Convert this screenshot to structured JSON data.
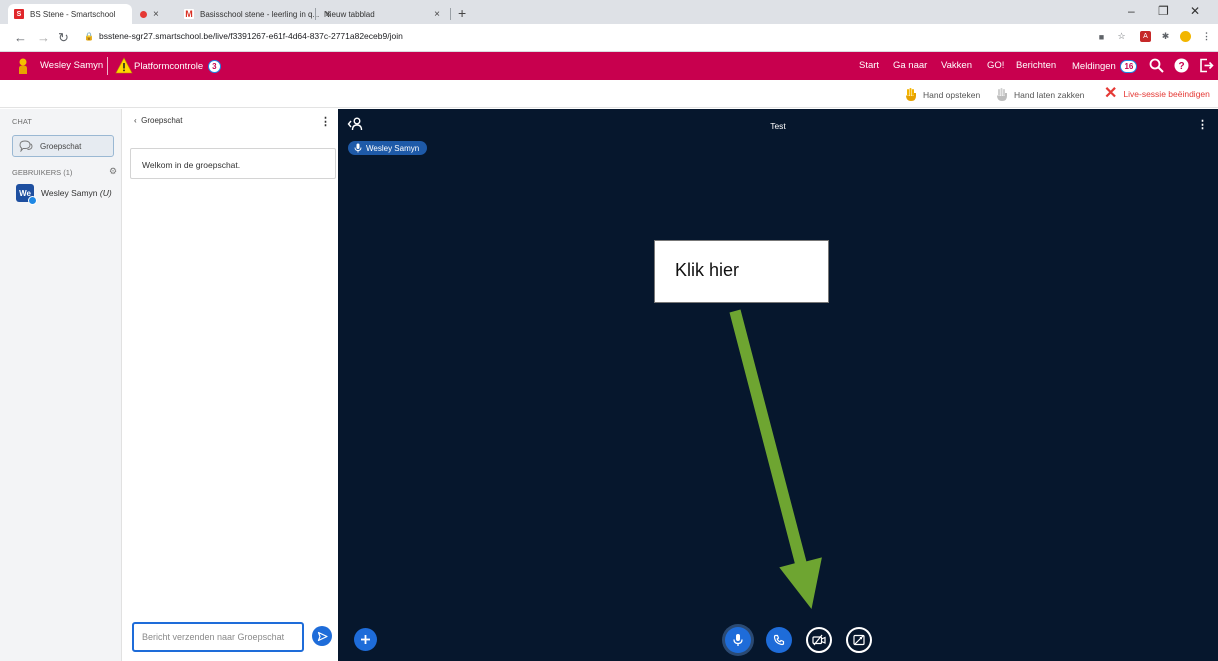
{
  "browser": {
    "tabs": [
      {
        "title": "BS Stene - Smartschool",
        "favicon": "S",
        "favicon_color": "#e0262a"
      },
      {
        "title": "",
        "recording": true,
        "close": "×"
      },
      {
        "title": "Basisschool stene - leerling in q...",
        "favicon": "M",
        "favicon_color": "#ffffff",
        "close": "×"
      },
      {
        "title": "Nieuw tabblad",
        "close": "×"
      }
    ],
    "new_tab": "+",
    "url": "bsstene-sgr27.smartschool.be/live/f3391267-e61f-4d64-837c-2771a82eceb9/join",
    "window_controls": {
      "minimize": "–",
      "maximize": "❐",
      "close": "✕"
    }
  },
  "header": {
    "user_name": "Wesley Samyn",
    "platform_control_label": "Platformcontrole",
    "platform_control_count": "3",
    "nav": [
      "Start",
      "Ga naar",
      "Vakken",
      "GO!",
      "Berichten",
      "Meldingen"
    ],
    "notifications_count": "16",
    "brand_color": "#c8004e"
  },
  "actions": {
    "raise_hand": "Hand opsteken",
    "lower_hand": "Hand laten zakken",
    "end_session": "Live-sessie beëindigen"
  },
  "sidebar": {
    "chat_header": "CHAT",
    "group_chat": "Groepschat",
    "users_header": "GEBRUIKERS (1)",
    "users": [
      {
        "avatar": "We",
        "name": "Wesley Samyn",
        "suffix": "(U)"
      }
    ]
  },
  "chat": {
    "header": "Groepschat",
    "welcome": "Welkom in de groepschat.",
    "input_placeholder": "Bericht verzenden naar Groepschat"
  },
  "presentation": {
    "title": "Test",
    "talking_user": "Wesley Samyn",
    "callout": "Klik hier",
    "callout_arrow_color": "#6ea531",
    "background_color": "#06172d",
    "controls": [
      {
        "name": "microphone",
        "state": "on"
      },
      {
        "name": "phone",
        "state": "on"
      },
      {
        "name": "camera",
        "state": "off"
      },
      {
        "name": "screen-share",
        "state": "off"
      }
    ]
  }
}
